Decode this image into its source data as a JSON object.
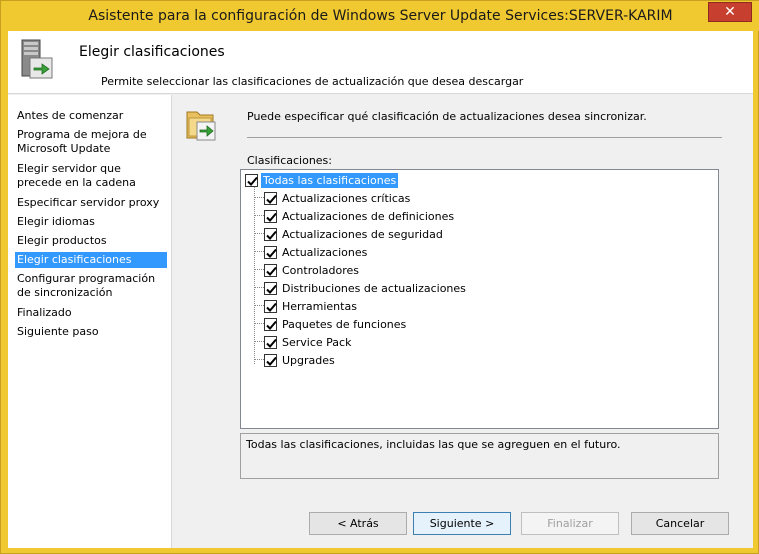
{
  "window": {
    "title": "Asistente para la configuración de Windows Server Update Services:SERVER-KARIM",
    "close_glyph": "✕"
  },
  "header": {
    "title": "Elegir clasificaciones",
    "subtitle": "Permite seleccionar las clasificaciones de actualización que desea descargar",
    "icon": "server-update-icon"
  },
  "nav": {
    "items": [
      {
        "label": "Antes de comenzar"
      },
      {
        "label": "Programa de mejora de Microsoft Update"
      },
      {
        "label": "Elegir servidor que precede en la cadena"
      },
      {
        "label": "Especificar servidor proxy"
      },
      {
        "label": "Elegir idiomas"
      },
      {
        "label": "Elegir productos"
      },
      {
        "label": "Elegir clasificaciones"
      },
      {
        "label": "Configurar programación de sincronización"
      },
      {
        "label": "Finalizado"
      },
      {
        "label": "Siguiente paso"
      }
    ],
    "selected_index": 6
  },
  "content": {
    "icon": "folder-sync-icon",
    "description": "Puede especificar qué clasificación de actualizaciones desea sincronizar.",
    "list_label": "Clasificaciones:",
    "root": {
      "label": "Todas las clasificaciones",
      "checked": true
    },
    "children": [
      {
        "label": "Actualizaciones críticas",
        "checked": true
      },
      {
        "label": "Actualizaciones de definiciones",
        "checked": true
      },
      {
        "label": "Actualizaciones de seguridad",
        "checked": true
      },
      {
        "label": "Actualizaciones",
        "checked": true
      },
      {
        "label": "Controladores",
        "checked": true
      },
      {
        "label": "Distribuciones de actualizaciones",
        "checked": true
      },
      {
        "label": "Herramientas",
        "checked": true
      },
      {
        "label": "Paquetes de funciones",
        "checked": true
      },
      {
        "label": "Service Pack",
        "checked": true
      },
      {
        "label": "Upgrades",
        "checked": true
      }
    ],
    "info_text": "Todas las clasificaciones, incluidas las que se agreguen en el futuro."
  },
  "buttons": {
    "back": "< Atrás",
    "next": "Siguiente >",
    "finish": "Finalizar",
    "cancel": "Cancelar"
  },
  "colors": {
    "title_bar": "#f0c830",
    "selection": "#3399ff",
    "close_button": "#c7402f"
  }
}
